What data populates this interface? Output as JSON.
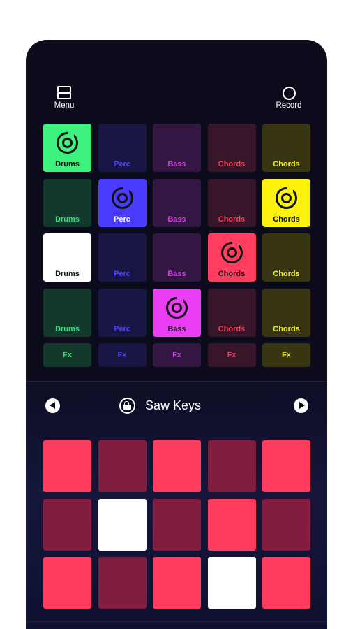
{
  "header": {
    "menu_label": "Menu",
    "record_label": "Record"
  },
  "colors": {
    "drums": "#2fe07a",
    "perc": "#4634f5",
    "bass": "#e43bf0",
    "chords_red": "#ff3d5f",
    "chords_yellow": "#f6f20a"
  },
  "pads": {
    "rows": [
      [
        {
          "label": "Drums",
          "active": true,
          "bg": "#3ef27f",
          "fg": "#0c0c0c",
          "ring": true
        },
        {
          "label": "Perc",
          "active": false,
          "bg": "#171645",
          "fg": "#4d44ff"
        },
        {
          "label": "Bass",
          "active": false,
          "bg": "#341643",
          "fg": "#d544e6"
        },
        {
          "label": "Chords",
          "active": false,
          "bg": "#361628",
          "fg": "#ff3d5f"
        },
        {
          "label": "Chords",
          "active": false,
          "bg": "#383612",
          "fg": "#f1ee14"
        }
      ],
      [
        {
          "label": "Drums",
          "active": false,
          "bg": "#123a2c",
          "fg": "#35dc7b"
        },
        {
          "label": "Perc",
          "active": true,
          "bg": "#4b3bff",
          "fg": "#ffffff",
          "ring": true
        },
        {
          "label": "Bass",
          "active": false,
          "bg": "#341643",
          "fg": "#d544e6"
        },
        {
          "label": "Chords",
          "active": false,
          "bg": "#361628",
          "fg": "#ff3d5f"
        },
        {
          "label": "Chords",
          "active": true,
          "bg": "#fdf20b",
          "fg": "#0c0c0c",
          "ring": true
        }
      ],
      [
        {
          "label": "Drums",
          "active": true,
          "bg": "#ffffff",
          "fg": "#111111"
        },
        {
          "label": "Perc",
          "active": false,
          "bg": "#171645",
          "fg": "#4d44ff"
        },
        {
          "label": "Bass",
          "active": false,
          "bg": "#341643",
          "fg": "#d544e6"
        },
        {
          "label": "Chords",
          "active": true,
          "bg": "#ff3d5f",
          "fg": "#141414",
          "ring": true
        },
        {
          "label": "Chords",
          "active": false,
          "bg": "#383612",
          "fg": "#f1ee14"
        }
      ],
      [
        {
          "label": "Drums",
          "active": false,
          "bg": "#123a2c",
          "fg": "#35dc7b"
        },
        {
          "label": "Perc",
          "active": false,
          "bg": "#171645",
          "fg": "#4d44ff"
        },
        {
          "label": "Bass",
          "active": true,
          "bg": "#ea3ef5",
          "fg": "#141414",
          "ring": true
        },
        {
          "label": "Chords",
          "active": false,
          "bg": "#361628",
          "fg": "#ff3d5f"
        },
        {
          "label": "Chords",
          "active": false,
          "bg": "#383612",
          "fg": "#f1ee14"
        }
      ]
    ],
    "fx_row": [
      {
        "label": "Fx",
        "bg": "#123a2c",
        "fg": "#35dc7b"
      },
      {
        "label": "Fx",
        "bg": "#171645",
        "fg": "#4d44ff"
      },
      {
        "label": "Fx",
        "bg": "#341643",
        "fg": "#d544e6"
      },
      {
        "label": "Fx",
        "bg": "#361628",
        "fg": "#ff3d5f"
      },
      {
        "label": "Fx",
        "bg": "#383612",
        "fg": "#f1ee14"
      }
    ]
  },
  "preset": {
    "name": "Saw Keys"
  },
  "keys": {
    "rows": [
      [
        "#ff3b5e",
        "#821d3f",
        "#ff3b5e",
        "#821d3f",
        "#ff3b5e"
      ],
      [
        "#821d3f",
        "#ffffff",
        "#821d3f",
        "#ff3b5e",
        "#821d3f"
      ],
      [
        "#ff3b5e",
        "#821d3f",
        "#ff3b5e",
        "#ffffff",
        "#ff3b5e"
      ]
    ]
  }
}
